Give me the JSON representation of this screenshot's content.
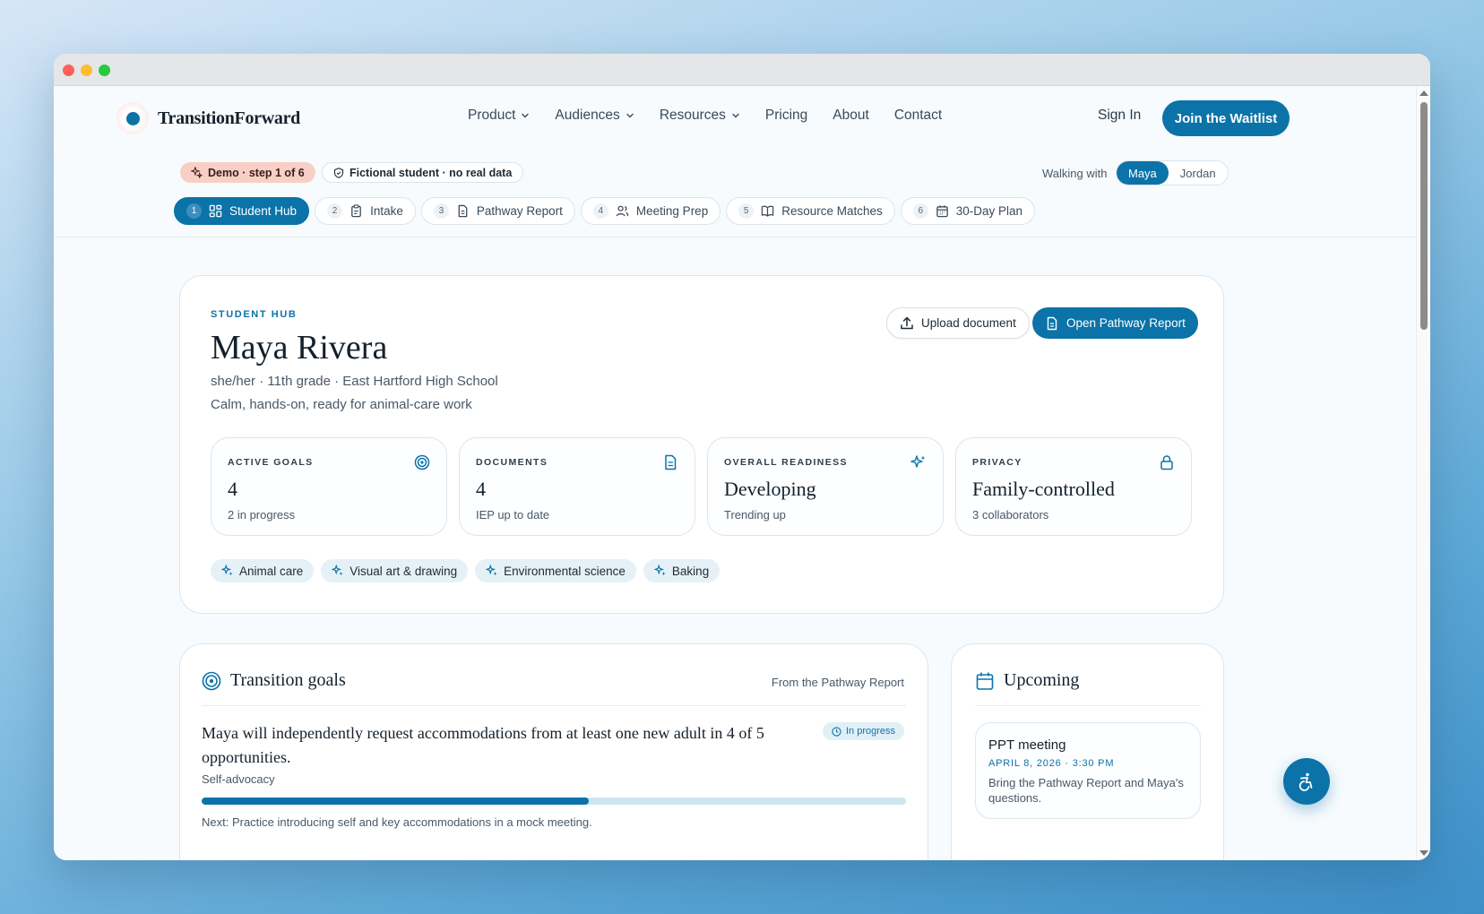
{
  "brand": {
    "name": "TransitionForward"
  },
  "nav": {
    "items": [
      "Product",
      "Audiences",
      "Resources",
      "Pricing",
      "About",
      "Contact"
    ],
    "sign_in": "Sign In",
    "cta": "Join the Waitlist"
  },
  "demo": {
    "badge": "Demo · step 1 of 6",
    "notice": "Fictional student · no real data",
    "walking_label": "Walking with",
    "students": [
      "Maya",
      "Jordan"
    ],
    "selected_student": "Maya"
  },
  "steps": [
    {
      "num": "1",
      "label": "Student Hub",
      "icon": "grid-icon",
      "active": true
    },
    {
      "num": "2",
      "label": "Intake",
      "icon": "clipboard-icon"
    },
    {
      "num": "3",
      "label": "Pathway Report",
      "icon": "document-icon"
    },
    {
      "num": "4",
      "label": "Meeting Prep",
      "icon": "users-icon"
    },
    {
      "num": "5",
      "label": "Resource Matches",
      "icon": "book-icon"
    },
    {
      "num": "6",
      "label": "30-Day Plan",
      "icon": "calendar-icon"
    }
  ],
  "hub": {
    "eyebrow": "STUDENT HUB",
    "name": "Maya Rivera",
    "meta": "she/her · 11th grade · East Hartford High School",
    "tagline": "Calm, hands-on, ready for animal-care work",
    "upload_label": "Upload document",
    "open_report_label": "Open Pathway Report",
    "stats": [
      {
        "label": "ACTIVE GOALS",
        "value": "4",
        "sub": "2 in progress",
        "icon": "target-icon"
      },
      {
        "label": "DOCUMENTS",
        "value": "4",
        "sub": "IEP up to date",
        "icon": "document-icon"
      },
      {
        "label": "OVERALL READINESS",
        "value": "Developing",
        "sub": "Trending up",
        "icon": "sparkles-icon"
      },
      {
        "label": "PRIVACY",
        "value": "Family-controlled",
        "sub": "3 collaborators",
        "icon": "lock-icon"
      }
    ],
    "interests": [
      "Animal care",
      "Visual art & drawing",
      "Environmental science",
      "Baking"
    ]
  },
  "goals": {
    "title": "Transition goals",
    "source": "From the Pathway Report",
    "items": [
      {
        "text": "Maya will independently request accommodations from at least one new adult in 4 of 5 opportunities.",
        "area": "Self-advocacy",
        "status": "In progress",
        "progress": 0.55,
        "note": "Next: Practice introducing self and key accommodations in a mock meeting."
      }
    ]
  },
  "upcoming": {
    "title": "Upcoming",
    "events": [
      {
        "title": "PPT meeting",
        "date": "APRIL 8, 2026 · 3:30 PM",
        "desc": "Bring the Pathway Report and Maya's questions."
      }
    ]
  },
  "colors": {
    "accent": "#0b73a8",
    "demo_badge": "#f8cfc7",
    "chip_bg": "#e6f1f7"
  }
}
